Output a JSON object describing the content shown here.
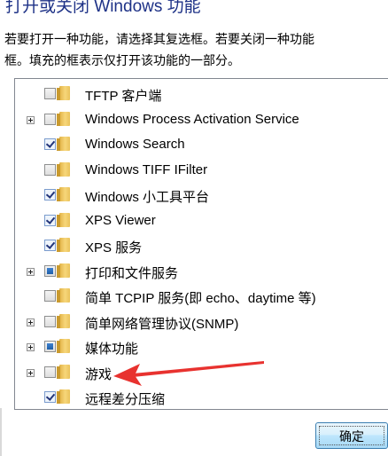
{
  "window": {
    "title": "打开或关闭 Windows 功能",
    "description": "若要打开一种功能，请选择其复选框。若要关闭一种功能\n框。填充的框表示仅打开该功能的一部分。"
  },
  "features": [
    {
      "label": "TFTP 客户端",
      "state": "unchecked",
      "expandable": false
    },
    {
      "label": "Windows Process Activation Service",
      "state": "unchecked",
      "expandable": true
    },
    {
      "label": "Windows Search",
      "state": "checked",
      "expandable": false
    },
    {
      "label": "Windows TIFF IFilter",
      "state": "unchecked",
      "expandable": false
    },
    {
      "label": "Windows 小工具平台",
      "state": "checked",
      "expandable": false
    },
    {
      "label": "XPS Viewer",
      "state": "checked",
      "expandable": false
    },
    {
      "label": "XPS 服务",
      "state": "checked",
      "expandable": false
    },
    {
      "label": "打印和文件服务",
      "state": "partial",
      "expandable": true
    },
    {
      "label": "简单 TCPIP 服务(即 echo、daytime 等)",
      "state": "unchecked",
      "expandable": false
    },
    {
      "label": "简单网络管理协议(SNMP)",
      "state": "unchecked",
      "expandable": true
    },
    {
      "label": "媒体功能",
      "state": "partial",
      "expandable": true
    },
    {
      "label": "游戏",
      "state": "unchecked",
      "expandable": true
    },
    {
      "label": "远程差分压缩",
      "state": "checked",
      "expandable": false
    }
  ],
  "buttons": {
    "ok_label": "确定"
  },
  "colors": {
    "title": "#1e3287",
    "annotation_arrow": "#e8322f"
  },
  "icons": {
    "folder": "folder-icon",
    "expander": "plus-expander-icon"
  }
}
